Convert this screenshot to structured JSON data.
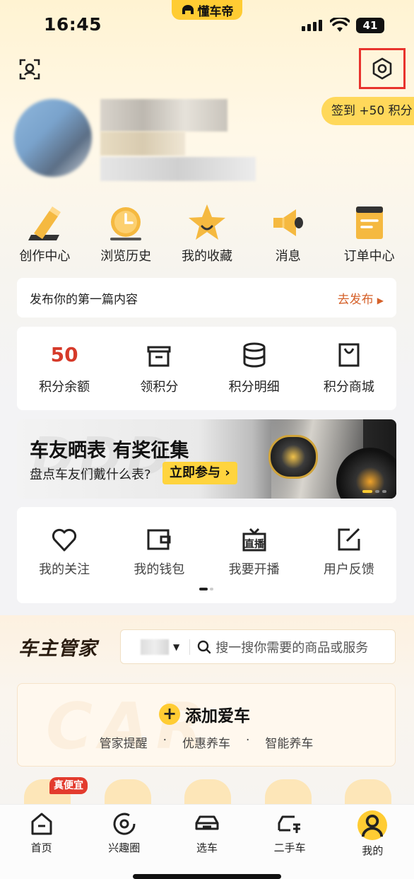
{
  "status_bar": {
    "time": "16:45",
    "app_badge": "懂车帝",
    "battery": "41"
  },
  "header": {
    "signin_label": "签到 +50 积分"
  },
  "quick_menu": [
    {
      "label": "创作中心",
      "icon": "pencil-icon"
    },
    {
      "label": "浏览历史",
      "icon": "clock-icon"
    },
    {
      "label": "我的收藏",
      "icon": "star-icon"
    },
    {
      "label": "消息",
      "icon": "megaphone-icon"
    },
    {
      "label": "订单中心",
      "icon": "order-icon"
    }
  ],
  "publish": {
    "text": "发布你的第一篇内容",
    "action": "去发布"
  },
  "points": {
    "balance_value": "50",
    "items": [
      {
        "label": "积分余额"
      },
      {
        "label": "领积分",
        "icon": "box-icon"
      },
      {
        "label": "积分明细",
        "icon": "database-icon"
      },
      {
        "label": "积分商城",
        "icon": "shopping-bag-icon"
      }
    ]
  },
  "banner": {
    "title": "车友晒表 有奖征集",
    "subtitle": "盘点车友们戴什么表?",
    "cta": "立即参与 ›"
  },
  "tools": [
    {
      "label": "我的关注",
      "icon": "heart-icon"
    },
    {
      "label": "我的钱包",
      "icon": "wallet-icon"
    },
    {
      "label": "我要开播",
      "icon": "live-icon"
    },
    {
      "label": "用户反馈",
      "icon": "feedback-icon"
    }
  ],
  "car_manager": {
    "title": "车主管家",
    "search_placeholder": "搜一搜你需要的商品或服务",
    "add_car": {
      "label": "添加爱车",
      "features": [
        "管家提醒",
        "优惠养车",
        "智能养车"
      ]
    },
    "promo_badge": "真便宜"
  },
  "tabbar": [
    {
      "label": "首页",
      "icon": "home-icon"
    },
    {
      "label": "兴趣圈",
      "icon": "circle-icon"
    },
    {
      "label": "选车",
      "icon": "car-icon"
    },
    {
      "label": "二手车",
      "icon": "used-car-icon"
    },
    {
      "label": "我的",
      "icon": "user-icon"
    }
  ],
  "colors": {
    "accent": "#ffcc33",
    "highlight_border": "#e8332d",
    "points_value": "#d63a2a",
    "publish_action": "#d5612a"
  }
}
